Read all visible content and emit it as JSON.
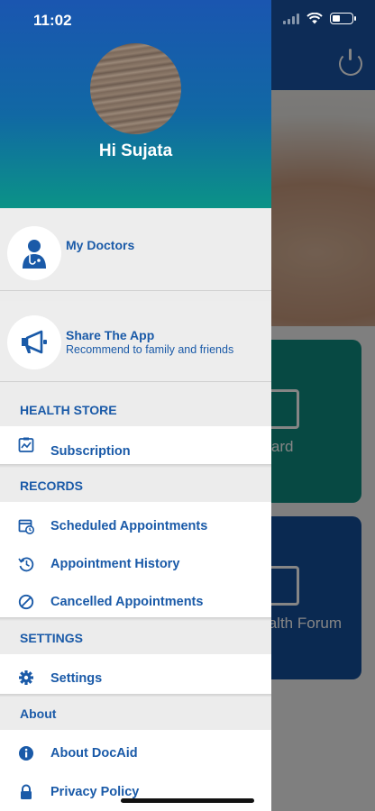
{
  "status_bar": {
    "time": "11:02"
  },
  "background_app": {
    "cards": [
      {
        "label": "shboard",
        "color": "#0f8c80"
      },
      {
        "label": "Health Forum",
        "color": "#154f9c"
      }
    ],
    "header_color": "#1a55a8"
  },
  "drawer": {
    "greeting": "Hi Sujata",
    "tiles": [
      {
        "title": "My Doctors",
        "subtitle": ""
      },
      {
        "title": "Share The App",
        "subtitle": "Recommend to family and friends"
      }
    ],
    "sections": [
      {
        "label": "HEALTH STORE",
        "items": [
          {
            "label": "Subscription",
            "icon": "subscription-icon"
          }
        ]
      },
      {
        "label": "RECORDS",
        "items": [
          {
            "label": "Scheduled Appointments",
            "icon": "calendar-clock-icon"
          },
          {
            "label": "Appointment History",
            "icon": "history-icon"
          },
          {
            "label": "Cancelled Appointments",
            "icon": "cancel-icon"
          }
        ]
      },
      {
        "label": "SETTINGS",
        "items": [
          {
            "label": "Settings",
            "icon": "gear-icon"
          }
        ]
      },
      {
        "label": "About",
        "items": [
          {
            "label": "About DocAid",
            "icon": "info-icon"
          },
          {
            "label": "Privacy Policy",
            "icon": "lock-icon"
          }
        ]
      }
    ],
    "accent_color": "#1a5aa8"
  }
}
